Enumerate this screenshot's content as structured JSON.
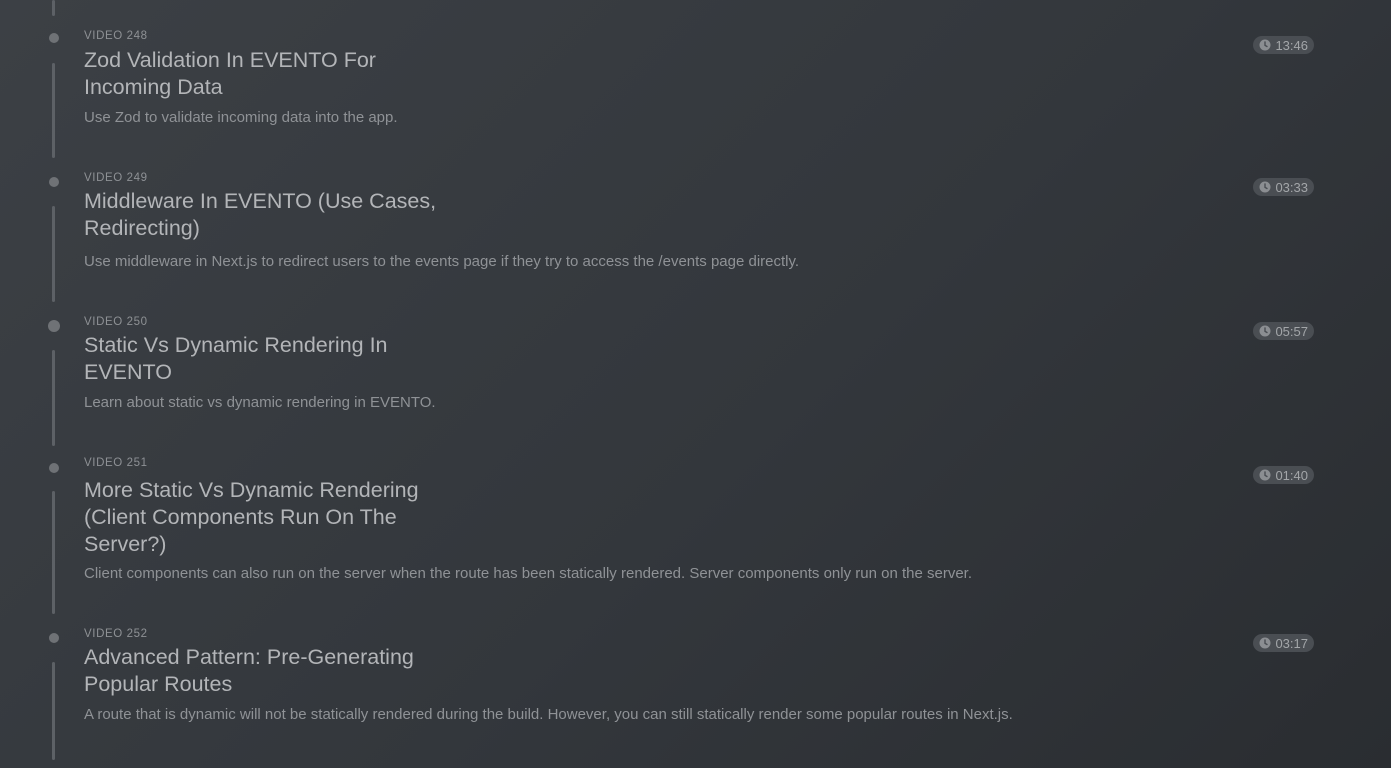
{
  "videos": [
    {
      "label": "VIDEO 248",
      "title": "Zod Validation In EVENTO For Incoming Data",
      "description": "Use Zod to validate incoming data into the app.",
      "duration": "13:46"
    },
    {
      "label": "VIDEO 249",
      "title": "Middleware In EVENTO (Use Cases, Redirecting)",
      "description": "Use middleware in Next.js to redirect users to the events page if they try to access the /events page directly.",
      "duration": "03:33"
    },
    {
      "label": "VIDEO 250",
      "title": "Static Vs Dynamic Rendering In EVENTO",
      "description": "Learn about static vs dynamic rendering in EVENTO.",
      "duration": "05:57"
    },
    {
      "label": "VIDEO 251",
      "title": "More Static Vs Dynamic Rendering (Client Components Run On The Server?)",
      "description": "Client components can also run on the server when the route has been statically rendered. Server components only run on the server.",
      "duration": "01:40"
    },
    {
      "label": "VIDEO 252",
      "title": "Advanced Pattern: Pre-Generating Popular Routes",
      "description": "A route that is dynamic will not be statically rendered during the build. However, you can still statically render some popular routes in Next.js.",
      "duration": "03:17"
    }
  ],
  "icons": {
    "duration_icon": "clock-icon"
  }
}
